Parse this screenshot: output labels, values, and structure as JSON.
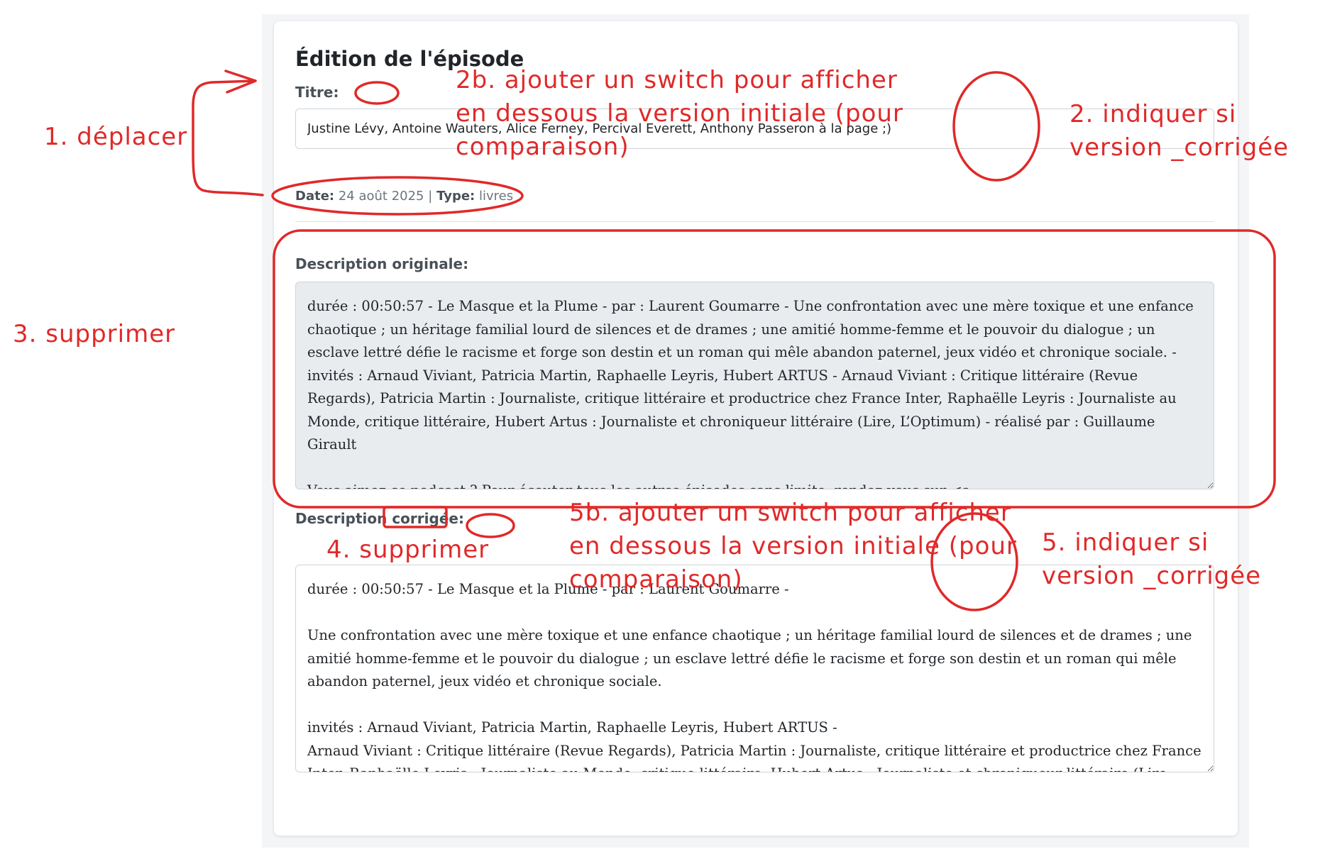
{
  "page": {
    "heading": "Édition de l'épisode",
    "title_label": "Titre:",
    "title_value": "Justine Lévy, Antoine Wauters, Alice Ferney, Percival Everett, Anthony Passeron à la page ;)",
    "meta": {
      "date_label": "Date:",
      "date_value": "24 août 2025",
      "separator": "|",
      "type_label": "Type:",
      "type_value": "livres"
    },
    "original": {
      "label": "Description originale:",
      "text": "durée : 00:50:57 - Le Masque et la Plume - par : Laurent Goumarre - Une confrontation avec une mère toxique et une enfance chaotique ; un héritage familial lourd de silences et de drames ; une amitié homme-femme et le pouvoir du dialogue ; un esclave lettré défie le racisme et forge son destin et un roman qui mêle abandon paternel, jeux vidéo et chronique sociale. - invités : Arnaud Viviant, Patricia Martin, Raphaelle Leyris, Hubert ARTUS - Arnaud Viviant : Critique littéraire (Revue Regards), Patricia Martin : Journaliste, critique littéraire et productrice chez France Inter, Raphaëlle Leyris : Journaliste au Monde, critique littéraire, Hubert Artus : Journaliste et chroniqueur littéraire (Lire, L’Optimum) - réalisé par : Guillaume Girault\n\nVous aimez ce podcast ? Pour écouter tous les autres épisodes sans limite, rendez-vous sur <a href=\"https://www.franceinter.fr/emissions/le-masque-et-la-plume?at_campaign=dsss_episode&amp;at_medium=lien_RSS\">Radio France</a>"
    },
    "corrected": {
      "label_prefix": "Description",
      "label_word": "corrigée:",
      "text": "durée : 00:50:57 - Le Masque et la Plume - par : Laurent Goumarre -\n\nUne confrontation avec une mère toxique et une enfance chaotique ; un héritage familial lourd de silences et de drames ; une amitié homme-femme et le pouvoir du dialogue ; un esclave lettré défie le racisme et forge son destin et un roman qui mêle abandon paternel, jeux vidéo et chronique sociale.\n\ninvités : Arnaud Viviant, Patricia Martin, Raphaelle Leyris, Hubert ARTUS -\nArnaud Viviant : Critique littéraire (Revue Regards), Patricia Martin : Journaliste, critique littéraire et productrice chez France Inter, Raphaëlle Leyris : Journaliste au Monde, critique littéraire, Hubert Artus : Journaliste et chroniqueur littéraire (Lire, L’Optimum)"
    }
  },
  "annotations": {
    "color": "#e02929",
    "n1": "1. déplacer",
    "n2b": "2b. ajouter un switch pour afficher\nen dessous la version initiale (pour\ncomparaison)",
    "n2": "2. indiquer si\nversion _corrigée",
    "n3": "3. supprimer",
    "n4": "4. supprimer",
    "n5b": "5b. ajouter un switch pour afficher\nen dessous la version initiale (pour\ncomparaison)",
    "n5": "5. indiquer si\nversion _corrigée"
  }
}
